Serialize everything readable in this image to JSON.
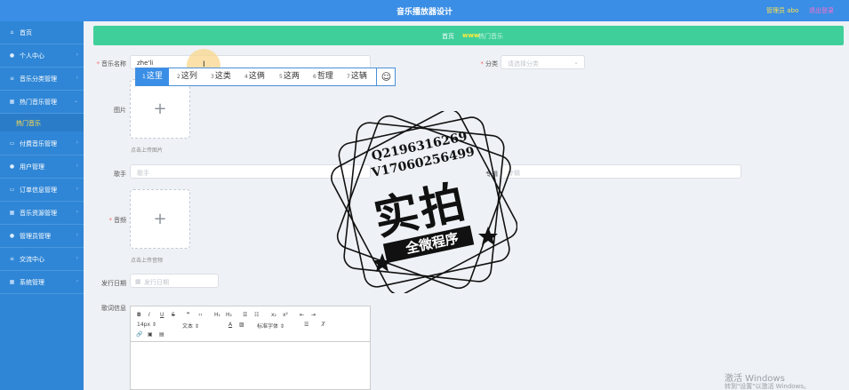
{
  "header": {
    "title": "音乐播放器设计",
    "user": "管理员 abo",
    "logout": "退出登录"
  },
  "sidebar": {
    "items": [
      {
        "label": "首页",
        "icon": "home-icon",
        "glyph": "⌂"
      },
      {
        "label": "个人中心",
        "icon": "person-icon",
        "glyph": "●"
      },
      {
        "label": "音乐分类管理",
        "icon": "list-icon",
        "glyph": "≡"
      },
      {
        "label": "热门音乐管理",
        "icon": "grid-icon",
        "glyph": "▦"
      },
      {
        "label": "付费音乐管理",
        "icon": "card-icon",
        "glyph": "▭"
      },
      {
        "label": "用户管理",
        "icon": "users-icon",
        "glyph": "●"
      },
      {
        "label": "订单信息管理",
        "icon": "order-icon",
        "glyph": "▭"
      },
      {
        "label": "音乐资源管理",
        "icon": "folder-icon",
        "glyph": "▦"
      },
      {
        "label": "管理员管理",
        "icon": "admin-icon",
        "glyph": "●"
      },
      {
        "label": "交流中心",
        "icon": "chat-icon",
        "glyph": "≡"
      },
      {
        "label": "系统管理",
        "icon": "settings-icon",
        "glyph": "▦"
      }
    ],
    "active_sub": "热门音乐"
  },
  "breadcrumb": {
    "home": "首页",
    "separator": "www",
    "current": "热门音乐"
  },
  "form": {
    "name_label": "音乐名称",
    "name_value": "zhe'li",
    "category_label": "分类",
    "category_placeholder": "请选择分类",
    "image_label": "图片",
    "image_hint": "点击上传图片",
    "singer_label": "歌手",
    "singer_placeholder": "歌手",
    "album_label": "专辑",
    "album_placeholder": "专辑",
    "audio_label": "音频",
    "audio_hint": "点击上传音频",
    "release_label": "发行日期",
    "release_placeholder": "发行日期",
    "lyrics_label": "歌词信息"
  },
  "ime": {
    "candidates": [
      {
        "n": "1",
        "text": "这里"
      },
      {
        "n": "2",
        "text": "这列"
      },
      {
        "n": "3",
        "text": "这类"
      },
      {
        "n": "4",
        "text": "这俩"
      },
      {
        "n": "5",
        "text": "这两"
      },
      {
        "n": "6",
        "text": "哲理"
      },
      {
        "n": "7",
        "text": "这辆"
      }
    ],
    "emoji": "☺"
  },
  "editor": {
    "row1": [
      "B",
      "I",
      "U",
      "S",
      "❞",
      "‹›",
      "H₁",
      "H₂",
      "☰",
      "☷",
      "x₂",
      "x²",
      "⇤",
      "⇥"
    ],
    "font_size": "14px",
    "text_style": "文本",
    "font_family": "标准字体",
    "row3": [
      "🔗",
      "▣",
      "▤"
    ]
  },
  "watermark": {
    "qq": "Q2196316269",
    "v": "V17060256499",
    "big": "实拍",
    "ribbon": "全微程序"
  },
  "windows": {
    "line1": "激活 Windows",
    "line2": "转到\"设置\"以激活 Windows。"
  }
}
